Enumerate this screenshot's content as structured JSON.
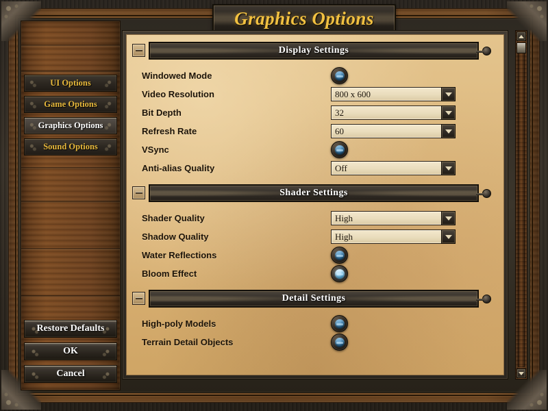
{
  "window": {
    "title": "Graphics Options"
  },
  "sidebar": {
    "nav_items": [
      {
        "label": "UI Options",
        "active": false
      },
      {
        "label": "Game Options",
        "active": false
      },
      {
        "label": "Graphics Options",
        "active": true
      },
      {
        "label": "Sound Options",
        "active": false
      }
    ],
    "actions": [
      {
        "label": "Restore Defaults"
      },
      {
        "label": "OK"
      },
      {
        "label": "Cancel"
      }
    ]
  },
  "sections": [
    {
      "title": "Display Settings",
      "collapse_icon": "minus-icon",
      "rows": [
        {
          "label": "Windowed Mode",
          "control": "toggle",
          "value": "on",
          "highlight": false
        },
        {
          "label": "Video Resolution",
          "control": "dropdown",
          "value": "800 x 600"
        },
        {
          "label": "Bit Depth",
          "control": "dropdown",
          "value": "32"
        },
        {
          "label": "Refresh Rate",
          "control": "dropdown",
          "value": "60"
        },
        {
          "label": "VSync",
          "control": "toggle",
          "value": "on",
          "highlight": false
        },
        {
          "label": "Anti-alias Quality",
          "control": "dropdown",
          "value": "Off"
        }
      ]
    },
    {
      "title": "Shader Settings",
      "collapse_icon": "minus-icon",
      "rows": [
        {
          "label": "Shader Quality",
          "control": "dropdown",
          "value": "High"
        },
        {
          "label": "Shadow Quality",
          "control": "dropdown",
          "value": "High"
        },
        {
          "label": "Water Reflections",
          "control": "toggle",
          "value": "on",
          "highlight": false
        },
        {
          "label": "Bloom Effect",
          "control": "toggle",
          "value": "on",
          "highlight": true
        }
      ]
    },
    {
      "title": "Detail Settings",
      "collapse_icon": "minus-icon",
      "rows": [
        {
          "label": "High-poly Models",
          "control": "toggle",
          "value": "on",
          "highlight": false
        },
        {
          "label": "Terrain Detail Objects",
          "control": "toggle",
          "value": "on",
          "highlight": false
        }
      ]
    }
  ],
  "scrollbar": {
    "up_icon": "triangle-up-icon",
    "down_icon": "triangle-down-icon",
    "thumb_position_percent": 3
  },
  "colors": {
    "title_gold": "#f2c141",
    "nav_gold": "#e8b93c",
    "active_white": "#ffffff",
    "parchment": "#ddb97f",
    "gem_blue": "#2f6d99",
    "gem_blue_bright": "#63b2dd",
    "wood": "#7a4e26"
  }
}
